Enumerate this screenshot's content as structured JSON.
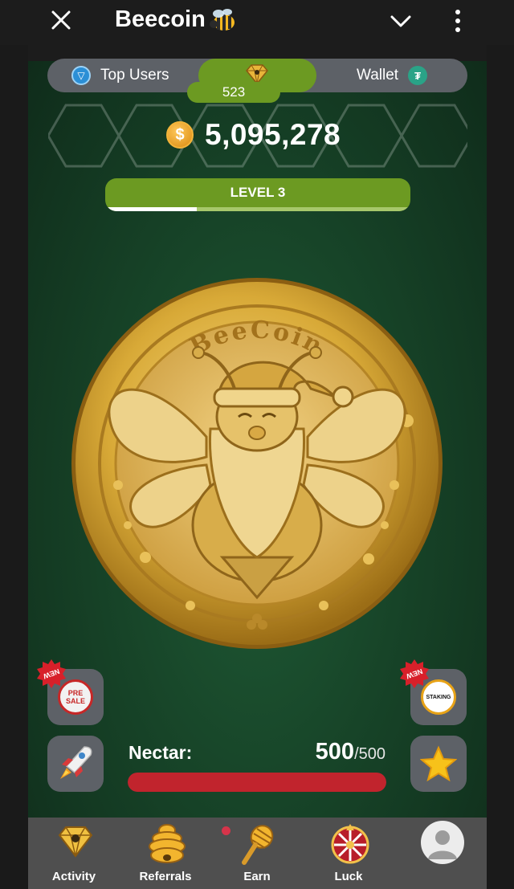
{
  "header": {
    "title": "Beecoin",
    "close_icon": "close-icon",
    "chevron_icon": "chevron-down-icon",
    "more_icon": "more-vertical-icon"
  },
  "tabs": {
    "top_users_label": "Top Users",
    "center_count": "523",
    "wallet_label": "Wallet",
    "top_users_icon": "ton-icon",
    "wallet_icon": "tether-icon"
  },
  "balance": {
    "value": "5,095,278",
    "icon": "dollar-coin-icon"
  },
  "level": {
    "label": "LEVEL 3",
    "progress_fraction": 0.3
  },
  "coin": {
    "engraved_text": "BeeCoin"
  },
  "side_buttons": {
    "presale_badge": "NEW",
    "presale_label_1": "PRE",
    "presale_label_2": "SALE",
    "staking_badge": "NEW",
    "staking_label": "STAKING"
  },
  "nectar": {
    "label": "Nectar:",
    "current": "500",
    "max": "/500",
    "fill_fraction": 1.0
  },
  "nav": {
    "items": [
      {
        "label": "Activity",
        "icon": "diamond-icon"
      },
      {
        "label": "Referrals",
        "icon": "beehive-icon"
      },
      {
        "label": "Earn",
        "icon": "honey-dipper-icon"
      },
      {
        "label": "Luck",
        "icon": "wheel-icon"
      }
    ],
    "profile_icon": "user-avatar-icon"
  },
  "colors": {
    "accent_green": "#6c9a22",
    "nectar_red": "#c1242d",
    "gold": "#d4a017",
    "dark_bg": "#1c1c1c"
  }
}
